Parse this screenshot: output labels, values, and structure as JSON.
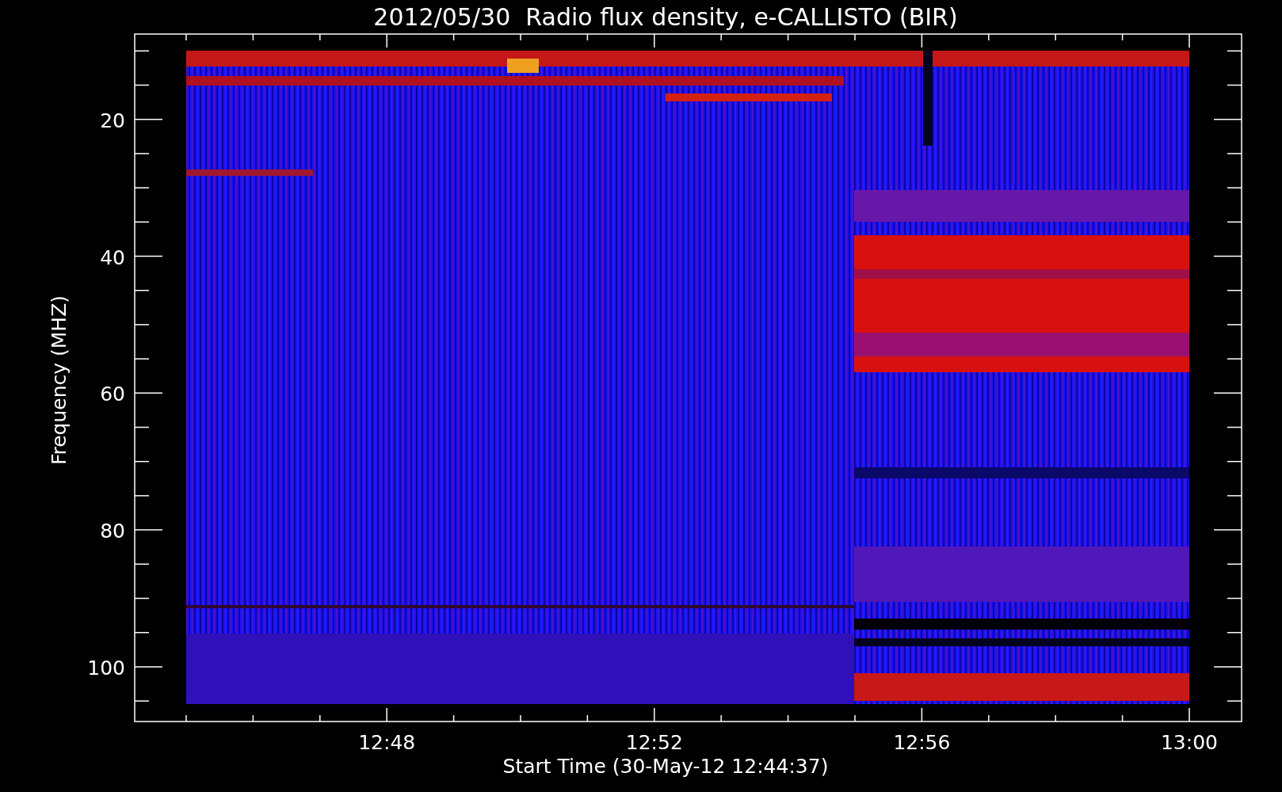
{
  "title": "2012/05/30  Radio flux density, e-CALLISTO (BIR)",
  "y_axis": {
    "label": "Frequency (MHZ)",
    "ticks": [
      "20",
      "40",
      "60",
      "80",
      "100"
    ]
  },
  "x_axis": {
    "label": "Start Time (30-May-12 12:44:37)",
    "ticks": [
      "12:48",
      "12:52",
      "12:56",
      "13:00"
    ]
  }
}
